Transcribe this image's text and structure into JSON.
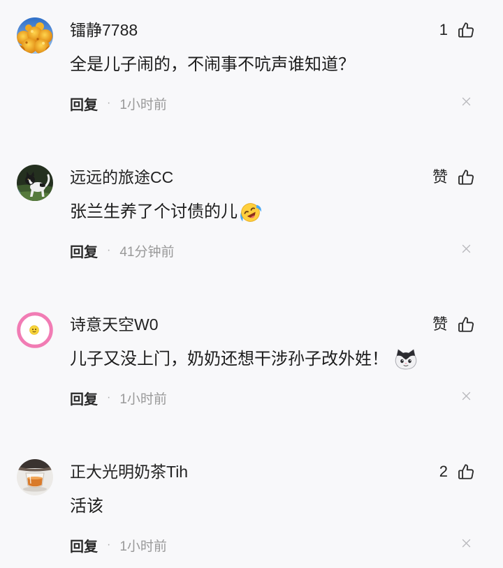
{
  "colors": {
    "background": "#f8f8fa",
    "text_primary": "#222222",
    "text_muted": "#999999",
    "icon": "#2b2b2b",
    "dismiss_icon": "#b8b8bc",
    "avatar_ring": "#f17cb4"
  },
  "icons": {
    "like": "thumbs-up-icon",
    "dismiss": "close-icon"
  },
  "labels": {
    "reply": "回复",
    "separator": "·"
  },
  "comments": [
    {
      "username": "镭静7788",
      "avatar": "orange-flowers-avatar",
      "like_label": "1",
      "text": "全是儿子闹的，不闹事不吭声谁知道？",
      "emoji": null,
      "time": "1小时前"
    },
    {
      "username": "远远的旅途CC",
      "avatar": "dog-photo-avatar",
      "like_label": "赞",
      "text": "张兰生养了个讨债的儿",
      "emoji": "crying-face-emoji",
      "time": "41分钟前"
    },
    {
      "username": "诗意天空W0",
      "avatar": "pink-ring-smiley-avatar",
      "like_label": "赞",
      "text": "儿子又没上门，奶奶还想干涉孙子改外姓！",
      "emoji": "cat-face-emoji",
      "time": "1小时前"
    },
    {
      "username": "正大光明奶茶Tih",
      "avatar": "tea-glass-avatar",
      "like_label": "2",
      "text": "活该",
      "emoji": null,
      "time": "1小时前"
    }
  ]
}
